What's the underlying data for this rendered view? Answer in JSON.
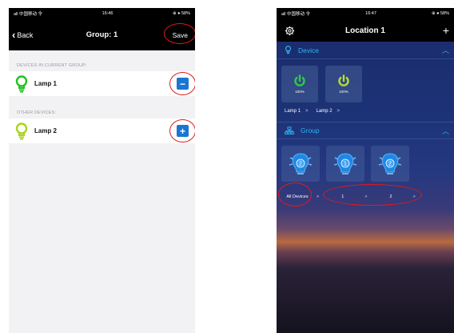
{
  "left": {
    "status": {
      "carrier": "all 中国移动 令",
      "time": "16:46",
      "battery": "⊕ ● 58%"
    },
    "nav": {
      "back": "Back",
      "title": "Group: 1",
      "save": "Save"
    },
    "sections": {
      "current": "DEVICES IN CURRENT GROUP:",
      "other": "OTHER DEVICES:"
    },
    "current_devices": [
      {
        "name": "Lamp 1",
        "action": "−"
      }
    ],
    "other_devices": [
      {
        "name": "Lamp 2",
        "action": "+"
      }
    ],
    "colors": {
      "bulb1": "#22c21c",
      "bulb2": "#a8d61c",
      "button": "#1a76d2",
      "highlight": "#e01b1b"
    }
  },
  "right": {
    "status": {
      "carrier": "all 中国移动 令",
      "time": "16:47",
      "battery": "⊕ ● 58%"
    },
    "nav": {
      "title": "Location 1",
      "add": "+"
    },
    "device_section": {
      "label": "Device"
    },
    "device_tiles": [
      {
        "percent": "100%",
        "name": "Lamp 1",
        "color": "#2ecc40"
      },
      {
        "percent": "100%",
        "name": "Lamp 2",
        "color": "#b6e02a"
      }
    ],
    "group_section": {
      "label": "Group"
    },
    "group_tiles": [
      {
        "count": "2",
        "name": "All Devices"
      },
      {
        "count": "1",
        "name": "1"
      },
      {
        "count": "2",
        "name": "2"
      }
    ],
    "colors": {
      "accent": "#29b6f6"
    }
  }
}
